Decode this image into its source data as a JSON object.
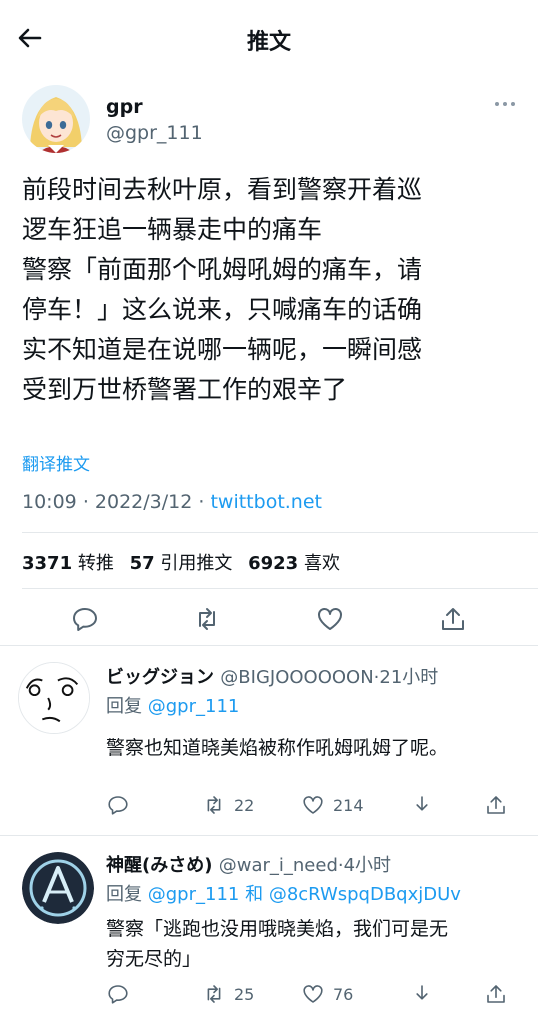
{
  "header": {
    "title": "推文"
  },
  "tweet": {
    "author_name": "gpr",
    "author_handle": "@gpr_111",
    "text": "前段时间去秋叶原，看到警察开着巡\n逻车狂追一辆暴走中的痛车\n警察「前面那个吼姆吼姆的痛车，请\n停车！」这么说来，只喊痛车的话确\n实不知道是在说哪一辆呢，一瞬间感\n受到万世桥警署工作的艰辛了",
    "translate_label": "翻译推文",
    "time": "10:09",
    "date": "2022/3/12",
    "separator": "·",
    "source": "twittbot.net",
    "stats": {
      "retweets": "3371",
      "retweets_label": "转推",
      "quotes": "57",
      "quotes_label": "引用推文",
      "likes": "6923",
      "likes_label": "喜欢"
    }
  },
  "replies": [
    {
      "name": "ビッグジョン",
      "handle": "@BIGJOOOOOON",
      "time": "21小时",
      "reply_prefix": "回复",
      "mention": "@gpr_111",
      "text": "警察也知道晓美焰被称作吼姆吼姆了呢。",
      "retweets": "22",
      "likes": "214"
    },
    {
      "name": "神醒(みさめ)",
      "handle": "@war_i_need",
      "time": "4小时",
      "reply_prefix": "回复",
      "mention": "@gpr_111",
      "joiner": "和",
      "mention2": "@8cRWspqDBqxjDUv",
      "text": "警察「逃跑也没用哦晓美焰，我们可是无\n穷无尽的」",
      "retweets": "25",
      "likes": "76"
    }
  ],
  "colors": {
    "accent": "#1d9bf0",
    "secondary_text": "#536471",
    "divider": "#e4e8eb"
  },
  "icons": [
    "back-arrow-icon",
    "more-icon",
    "reply-icon",
    "retweet-icon",
    "like-icon",
    "share-icon"
  ]
}
